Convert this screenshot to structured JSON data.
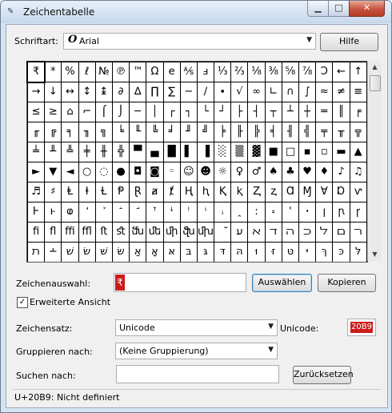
{
  "window": {
    "title": "Zeichentabelle"
  },
  "controls": {
    "min": "▁",
    "max": "□",
    "close": "✕"
  },
  "font": {
    "label": "Schriftart:",
    "value": "Arial",
    "glyph": "O",
    "help_button": "Hilfe"
  },
  "grid": {
    "selected_index": 0,
    "chars": [
      "₹",
      "*",
      "%",
      "ℓ",
      "№",
      "℗",
      "™",
      "Ω",
      "e",
      "⅍",
      "ⅎ",
      "⅓",
      "⅔",
      "⅛",
      "⅜",
      "⅝",
      "⅞",
      "Ↄ",
      "←",
      "↑",
      "→",
      "↓",
      "↔",
      "↕",
      "↨",
      "∂",
      "∆",
      "∏",
      "∑",
      "−",
      "∕",
      "∙",
      "√",
      "∞",
      "∟",
      "∩",
      "∫",
      "≈",
      "≠",
      "≡",
      "≤",
      "≥",
      "⌂",
      "⌐",
      "⌠",
      "⌡",
      "─",
      "│",
      "┌",
      "┐",
      "└",
      "┘",
      "├",
      "┤",
      "┬",
      "┴",
      "┼",
      "═",
      "║",
      "╒",
      "╓",
      "╔",
      "╕",
      "╖",
      "╗",
      "╘",
      "╙",
      "╚",
      "╛",
      "╜",
      "╝",
      "╞",
      "╟",
      "╠",
      "╡",
      "╢",
      "╣",
      "╤",
      "╥",
      "╦",
      "╧",
      "╨",
      "╩",
      "╪",
      "╫",
      "╬",
      "▀",
      "▄",
      "█",
      "▌",
      "▐",
      "░",
      "▒",
      "▓",
      "■",
      "□",
      "▪",
      "▫",
      "▬",
      "▲",
      "►",
      "▼",
      "◄",
      "○",
      "◌",
      "●",
      "◘",
      "◙",
      "◦",
      "☺",
      "☻",
      "☼",
      "♀",
      "♂",
      "♠",
      "♣",
      "♥",
      "♦",
      "♪",
      "♫",
      "♬",
      "♯",
      "Ⱡ",
      "ⱡ",
      "Ɫ",
      "Ᵽ",
      "Ɽ",
      "ⱥ",
      "ⱦ",
      "Ⱨ",
      "ⱨ",
      "Ⱪ",
      "ⱪ",
      "Ⱬ",
      "ⱬ",
      "Ɑ",
      "Ɱ",
      "Ɐ",
      "Ɒ",
      "ⱱ",
      "Ⱶ",
      "ⱶ",
      "ⱷ",
      "ꜗ",
      "ꜘ",
      "ꜙ",
      "ꜚ",
      "ꜛ",
      "ꜜ",
      "ꜝ",
      "ꜞ",
      "ꜟ",
      "ꞈ",
      "꞉",
      "꞊",
      "ꞌ",
      "ꞏ",
      "ꞁ",
      "ꞃ",
      "ꞅ",
      "ﬁ",
      "ﬂ",
      "ﬃ",
      "ﬄ",
      "ﬅ",
      "ﬆ",
      "ﬓ",
      "ﬔ",
      "ﬕ",
      "ﬖ",
      "ﬗ",
      "ﬞ",
      "ﬠ",
      "ﬡ",
      "ﬢ",
      "ﬣ",
      "ﬤ",
      "ﬥ",
      "ﬦ",
      "ﬧ",
      "ﬨ",
      "﬩",
      "שׁ",
      "שׂ",
      "שּׁ",
      "שּׂ",
      "אַ",
      "אָ",
      "אּ",
      "בּ",
      "גּ",
      "דּ",
      "הּ",
      "וּ",
      "זּ",
      "טּ",
      "יּ",
      "ךּ",
      "כּ",
      "לּ"
    ]
  },
  "selection": {
    "label": "Zeichenauswahl:",
    "value": "₹",
    "select_button": "Auswählen",
    "copy_button": "Kopieren"
  },
  "advanced": {
    "label": "Erweiterte Ansicht",
    "checked": true,
    "check_glyph": "✓"
  },
  "charset": {
    "label": "Zeichensatz:",
    "value": "Unicode",
    "unicode_label": "Unicode:",
    "unicode_value": "20B9"
  },
  "group": {
    "label": "Gruppieren nach:",
    "value": "(Keine Gruppierung)"
  },
  "search": {
    "label": "Suchen nach:",
    "value": "",
    "reset_button": "Zurücksetzen"
  },
  "status": {
    "text": "U+20B9: Nicht definiert"
  }
}
